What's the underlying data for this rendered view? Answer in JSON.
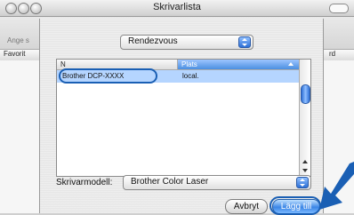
{
  "window": {
    "title": "Skrivarlista",
    "toolbar_label": "Ange s",
    "list_columns": {
      "left": "Favorit",
      "right": "rd"
    }
  },
  "sheet": {
    "browser_popup": {
      "selected": "Rendezvous"
    },
    "table": {
      "columns": [
        "N",
        "Plats"
      ],
      "rows": [
        {
          "name": "Brother  DCP-XXXX",
          "location": "local."
        }
      ]
    },
    "printer_model": {
      "label": "Skrivarmodell:",
      "selected": "Brother Color Laser"
    },
    "buttons": {
      "cancel": "Avbryt",
      "add": "Lägg till"
    }
  },
  "colors": {
    "accent": "#1a5fb4",
    "selection": "#b5d5ff",
    "aqua_blue": "#3b86e6"
  }
}
